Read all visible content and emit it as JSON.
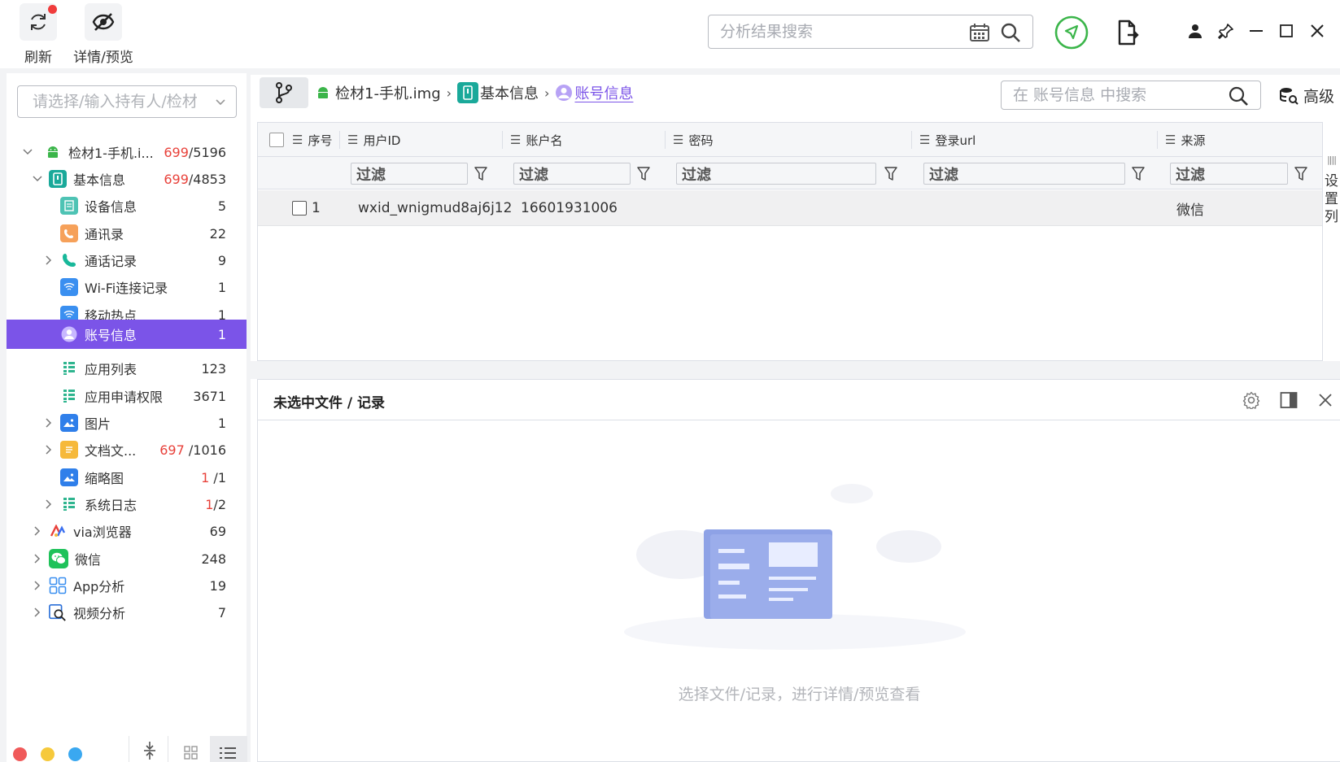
{
  "toolbar": {
    "refresh_label": "刷新",
    "details_label": "详情/预览"
  },
  "global_search": {
    "placeholder": "分析结果搜索"
  },
  "sidebar": {
    "selector_placeholder": "请选择/输入持有人/检材",
    "tree": [
      {
        "label": "检材1-手机.i...",
        "count_red": "699",
        "count_rest": "/5196"
      },
      {
        "label": "基本信息",
        "count_red": "699",
        "count_rest": "/4853"
      },
      {
        "label": "设备信息",
        "count": "5"
      },
      {
        "label": "通讯录",
        "count": "22"
      },
      {
        "label": "通话记录",
        "count": "9"
      },
      {
        "label": "Wi-Fi连接记录",
        "count": "1"
      },
      {
        "label": "移动热点",
        "count": "1"
      },
      {
        "label": "账号信息",
        "count": "1"
      },
      {
        "label": "应用列表",
        "count": "123"
      },
      {
        "label": "应用申请权限",
        "count": "3671"
      },
      {
        "label": "图片",
        "count": "1"
      },
      {
        "label": "文档文...",
        "count_red": "697",
        "count_rest": " /1016"
      },
      {
        "label": "缩略图",
        "count_red": "1",
        "count_rest": " /1"
      },
      {
        "label": "系统日志",
        "count_red": "1",
        "count_rest": "/2"
      },
      {
        "label": "via浏览器",
        "count": "69"
      },
      {
        "label": "微信",
        "count": "248"
      },
      {
        "label": "App分析",
        "count": "19"
      },
      {
        "label": "视频分析",
        "count": "7"
      }
    ]
  },
  "breadcrumb": {
    "item1": "检材1-手机.img",
    "item2": "基本信息",
    "item3": "账号信息"
  },
  "table_search": {
    "placeholder": "在 账号信息 中搜索"
  },
  "advanced_label": "高级",
  "table": {
    "headers": {
      "seq": "序号",
      "userid": "用户ID",
      "account": "账户名",
      "password": "密码",
      "url": "登录url",
      "source": "来源"
    },
    "filter_placeholder": "过滤",
    "rows": [
      {
        "seq": "1",
        "userid": "wxid_wnigmud8aj6j12",
        "account": "16601931006",
        "password": "",
        "url": "",
        "source": "微信"
      }
    ]
  },
  "set_columns_label": [
    "设",
    "置",
    "列"
  ],
  "detail": {
    "title": "未选中文件 / 记录",
    "empty_text": "选择文件/记录，进行详情/预览查看"
  },
  "colors": {
    "accent": "#7b54e8",
    "count_red": "#e8413a",
    "green": "#3bb54a"
  }
}
